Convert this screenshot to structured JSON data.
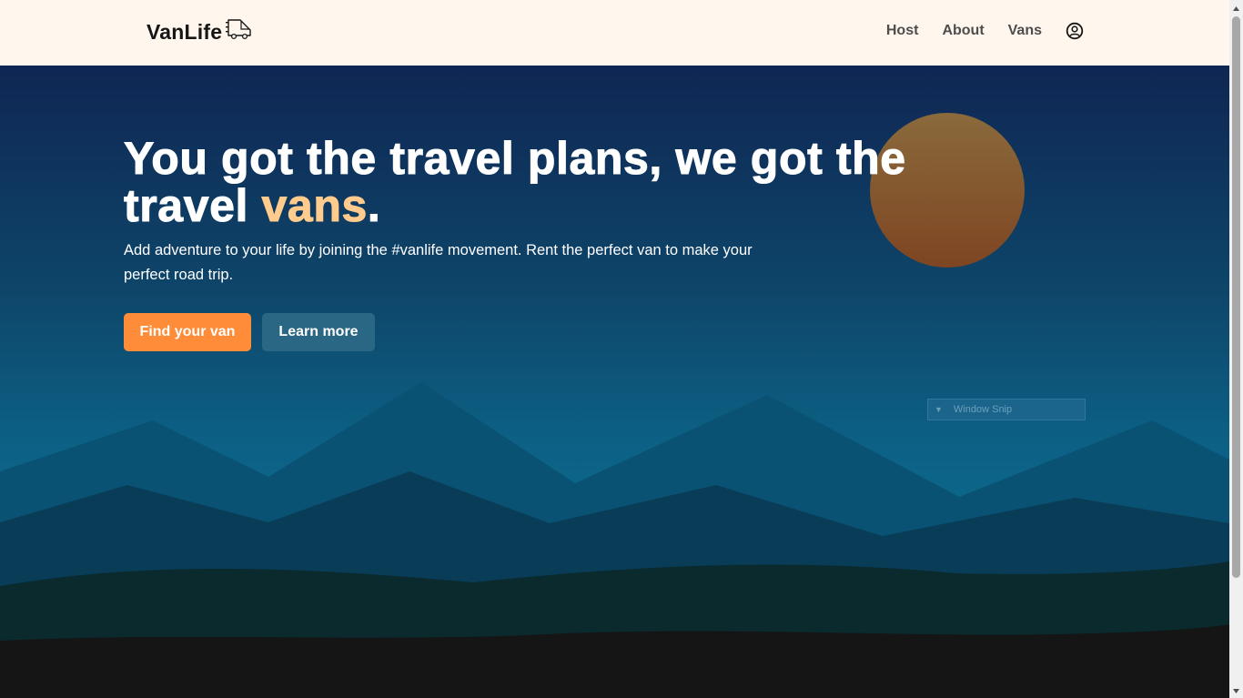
{
  "header": {
    "logo_text": "VanLife",
    "logo_icon": "van-icon",
    "nav": [
      {
        "label": "Host"
      },
      {
        "label": "About"
      },
      {
        "label": "Vans"
      }
    ],
    "profile_icon": "user-circle-icon"
  },
  "hero": {
    "headline_main": "You got the travel plans, we got the travel ",
    "headline_accent": "vans",
    "headline_end": ".",
    "subtext": "Add adventure to your life by joining the #vanlife movement. Rent the perfect van to make your perfect road trip.",
    "primary_button": "Find your van",
    "secondary_button": "Learn more"
  },
  "overlay": {
    "window_snip_label": "Window Snip"
  },
  "colors": {
    "header_bg": "#FFF7ED",
    "accent": "#FFCC8D",
    "primary_button": "#FF8C38",
    "secondary_button": "#2A6785",
    "sky_top": "#0F2653",
    "sky_bottom": "#0B6A8C",
    "sun": "#8A5A2E",
    "ground": "#151515"
  }
}
